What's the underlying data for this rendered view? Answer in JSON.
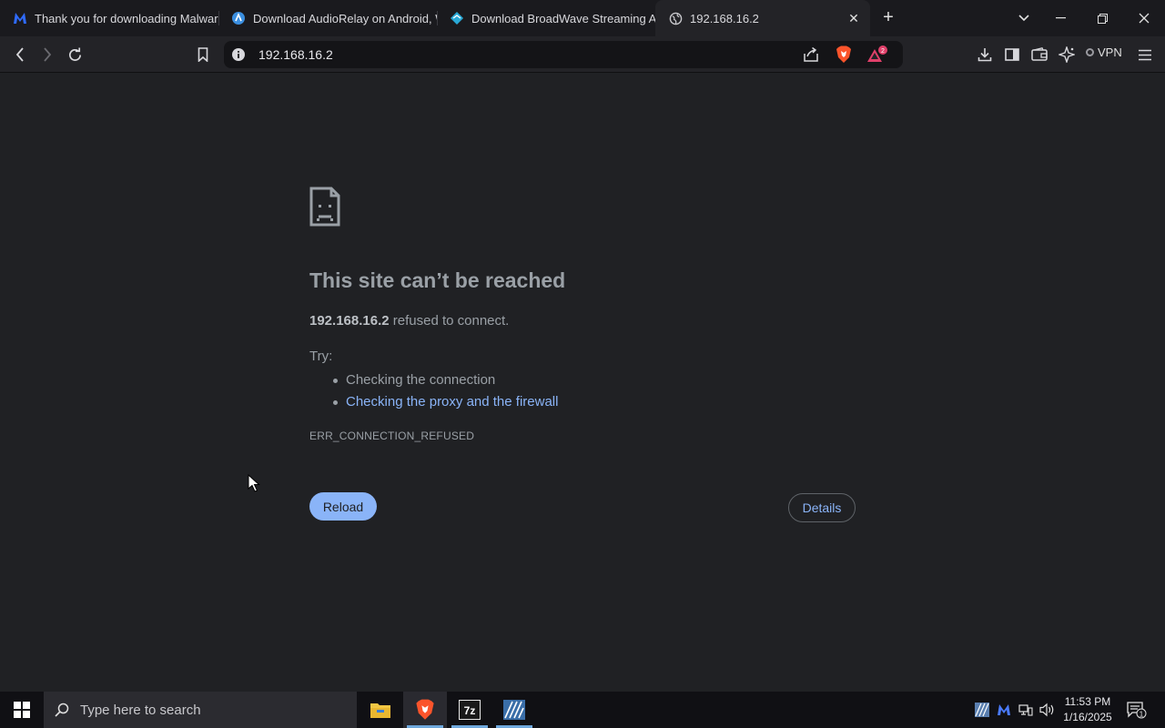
{
  "browser": {
    "tabs": [
      {
        "title": "Thank you for downloading Malwarebytes",
        "icon": "malwarebytes-icon",
        "active": false
      },
      {
        "title": "Download AudioRelay on Android, Windows",
        "icon": "audiorelay-icon",
        "active": false
      },
      {
        "title": "Download BroadWave Streaming Audio Server",
        "icon": "broadwave-icon",
        "active": false
      },
      {
        "title": "192.168.16.2",
        "icon": "globe-icon",
        "active": true
      }
    ],
    "address": "192.168.16.2",
    "vpn_label": "VPN",
    "notification_count": "2"
  },
  "error_page": {
    "title": "This site can’t be reached",
    "host": "192.168.16.2",
    "desc_suffix": " refused to connect.",
    "try_label": "Try:",
    "suggestions": [
      "Checking the connection",
      "Checking the proxy and the firewall"
    ],
    "error_code": "ERR_CONNECTION_REFUSED",
    "reload_label": "Reload",
    "details_label": "Details"
  },
  "taskbar": {
    "search_placeholder": "Type here to search",
    "time": "11:53 PM",
    "date": "1/16/2025",
    "notification_badge": "1"
  },
  "colors": {
    "link": "#8ab4f8",
    "page_bg": "#202124",
    "text": "#9aa0a6"
  }
}
